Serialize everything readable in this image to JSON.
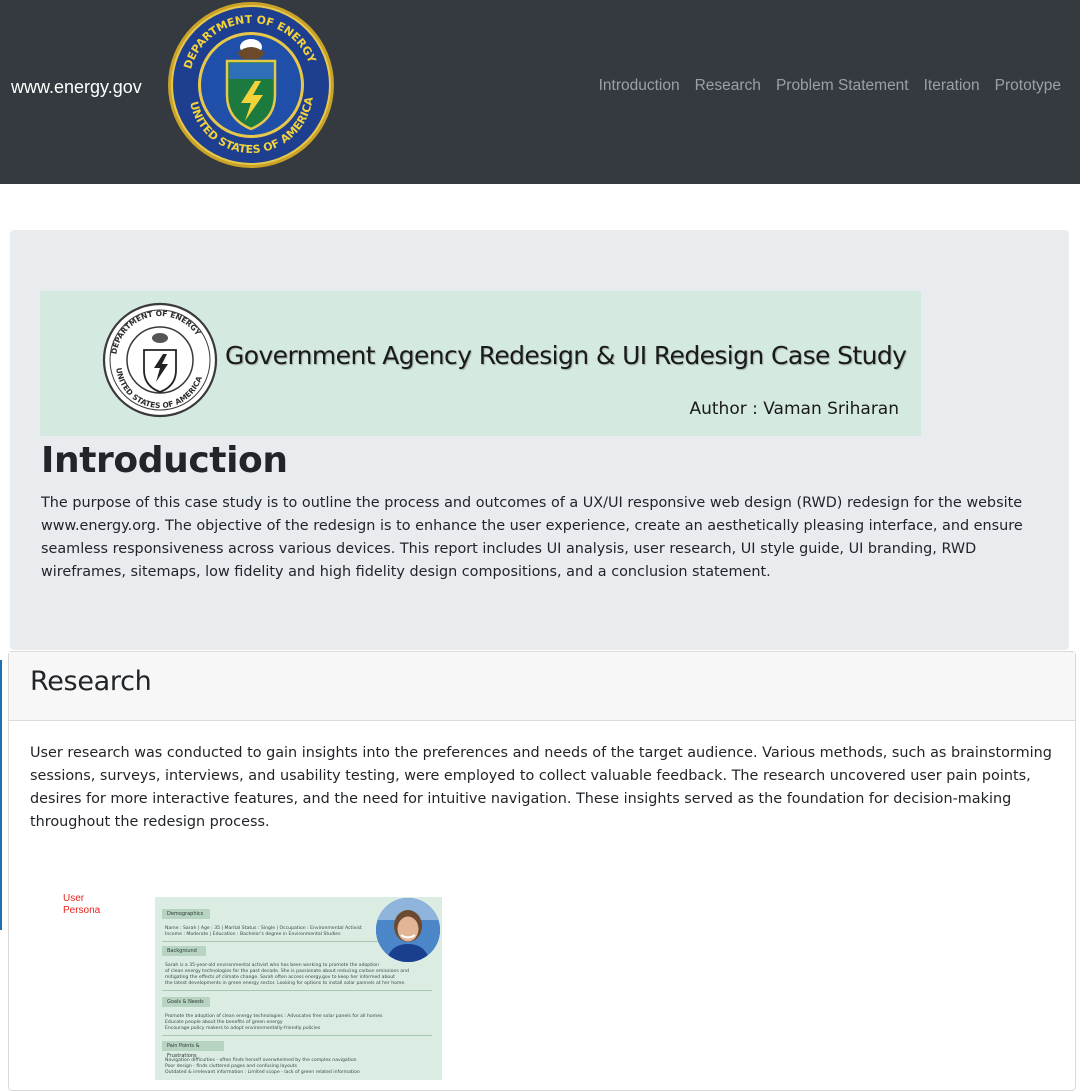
{
  "nav": {
    "brand": "www.energy.gov",
    "links": [
      "Introduction",
      "Research",
      "Problem Statement",
      "Iteration",
      "Prototype"
    ]
  },
  "banner": {
    "title": "Government Agency Redesign & UI Redesign Case Study",
    "author": "Author : Vaman Sriharan"
  },
  "intro": {
    "heading": "Introduction",
    "text": "The purpose of this case study is to outline the process and outcomes of a UX/UI responsive web design (RWD) redesign for the website www.energy.org. The objective of the redesign is to enhance the user experience, create an aesthetically pleasing interface, and ensure seamless responsiveness across various devices. This report includes UI analysis, user research, UI style guide, UI branding, RWD wireframes, sitemaps, low fidelity and high fidelity design compositions, and a conclusion statement."
  },
  "research": {
    "heading": "Research",
    "text": "User research was conducted to gain insights into the preferences and needs of the target audience. Various methods, such as brainstorming sessions, surveys, interviews, and usability testing, were employed to collect valuable feedback. The research uncovered user pain points, desires for more interactive features, and the need for intuitive navigation. These insights served as the foundation for decision-making throughout the redesign process."
  },
  "persona": {
    "label_line1": "User",
    "label_line2": "Persona",
    "demographics_title": "Demographics",
    "demographics_line1": "Name : Sarah  |  Age : 35  |  Marital Status : Single  |  Occupation : Environmental Activist",
    "demographics_line2": "Income : Moderate  |  Education : Bachelor's degree in Environmental Studies",
    "background_title": "Background",
    "background_line1": "Sarah is a 35-year-old environmental activist who has been working to promote the adoption",
    "background_line2": "of clean energy technologies for the past decade. She is passionate about reducing carbon emissions and",
    "background_line3": "mitigating the effects of climate change. Sarah often access energy.gov to keep her informed about",
    "background_line4": "the latest developments in green energy sector. Looking for options to install solar pannels at her home.",
    "goals_title": "Goals & Needs",
    "goals_line1": "Promote the adoption of clean energy technologies  :  Advocates free solar panels for all homes",
    "goals_line2": "Educate people about the benefits of green energy",
    "goals_line3": "Encourage policy makers to adopt environmentally-friendly policies",
    "pain_title": "Pain Points & Frustrations",
    "pain_line1": "Navigation difficulties - often finds herself overwhelmed by the complex navigation",
    "pain_line2": "Poor design - finds cluttered pages and confusing layouts",
    "pain_line3": "Outdated & irrelevant information  :  Limited scope - lack of green related information"
  },
  "colors": {
    "navbar": "#343a40",
    "jumbotron": "#e9ecef",
    "banner": "#d4e9e0",
    "persona_label": "#e8231f"
  }
}
